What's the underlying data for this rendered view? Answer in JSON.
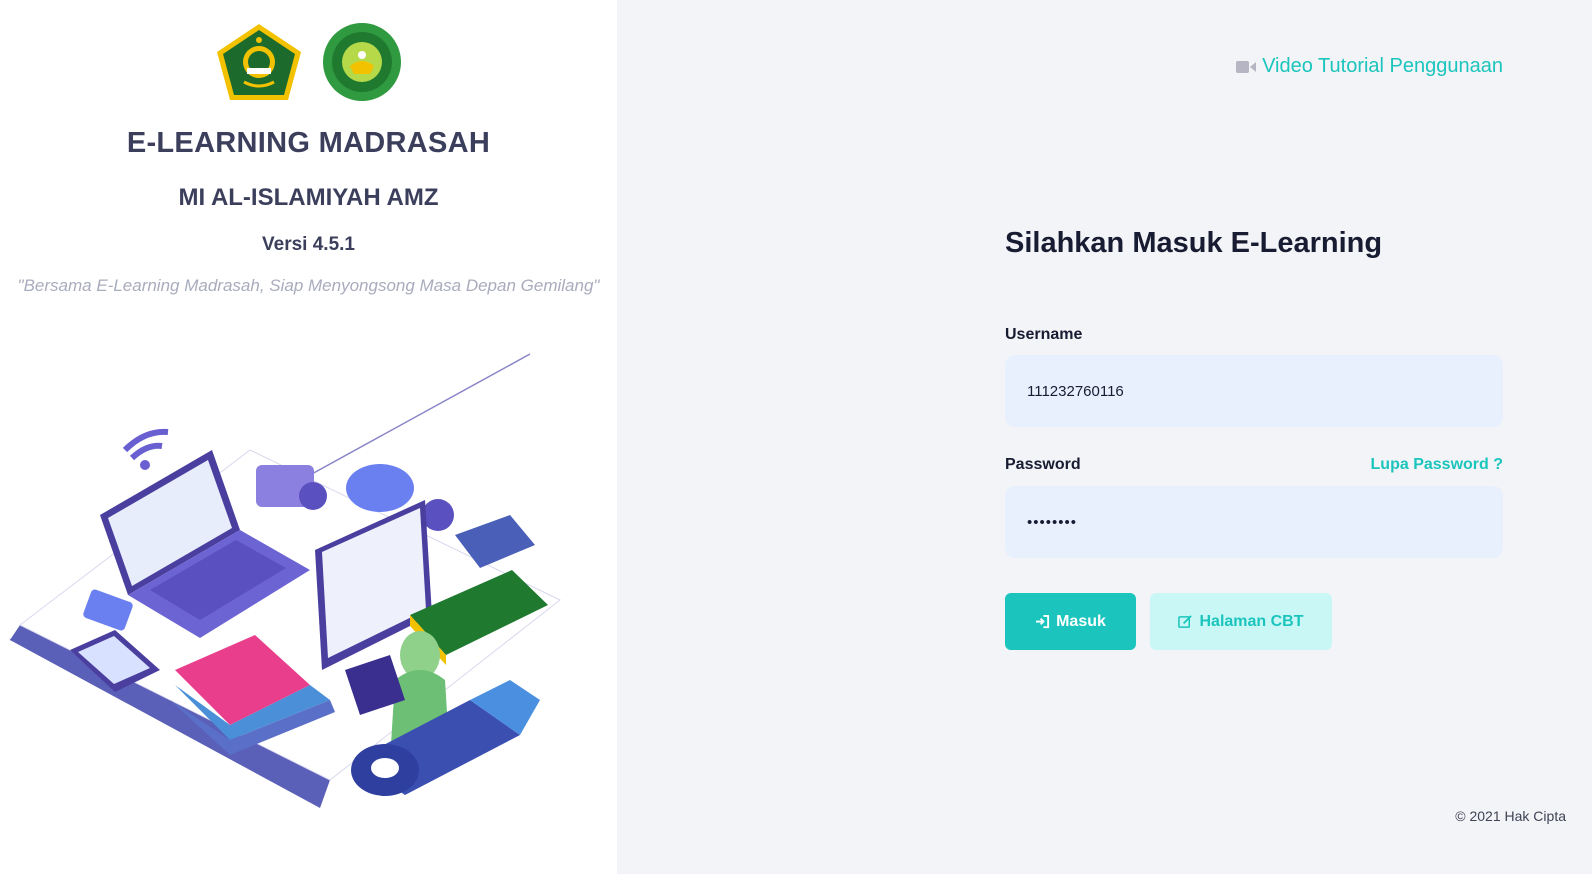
{
  "brand": {
    "app_title": "E-LEARNING MADRASAH",
    "school_name": "MI AL-ISLAMIYAH AMZ",
    "version": "Versi 4.5.1",
    "tagline": "\"Bersama E-Learning Madrasah, Siap Menyongsong Masa Depan Gemilang\""
  },
  "header": {
    "tutorial_link": "Video Tutorial Penggunaan",
    "tutorial_icon": "video-camera-icon"
  },
  "login": {
    "title": "Silahkan Masuk E-Learning",
    "username_label": "Username",
    "username_value": "111232760116",
    "password_label": "Password",
    "password_value": "••••••••",
    "forgot_link": "Lupa Password ?",
    "login_button": "Masuk",
    "login_icon": "sign-in-icon",
    "cbt_button": "Halaman CBT",
    "cbt_icon": "edit-icon"
  },
  "footer": {
    "copyright": "© 2021 Hak Cipta"
  },
  "colors": {
    "accent": "#1bc5bd",
    "accent_light": "#c9f7f5",
    "input_bg": "#e8f0fe",
    "heading": "#3b3f5c",
    "page_bg": "#f3f4f7"
  }
}
